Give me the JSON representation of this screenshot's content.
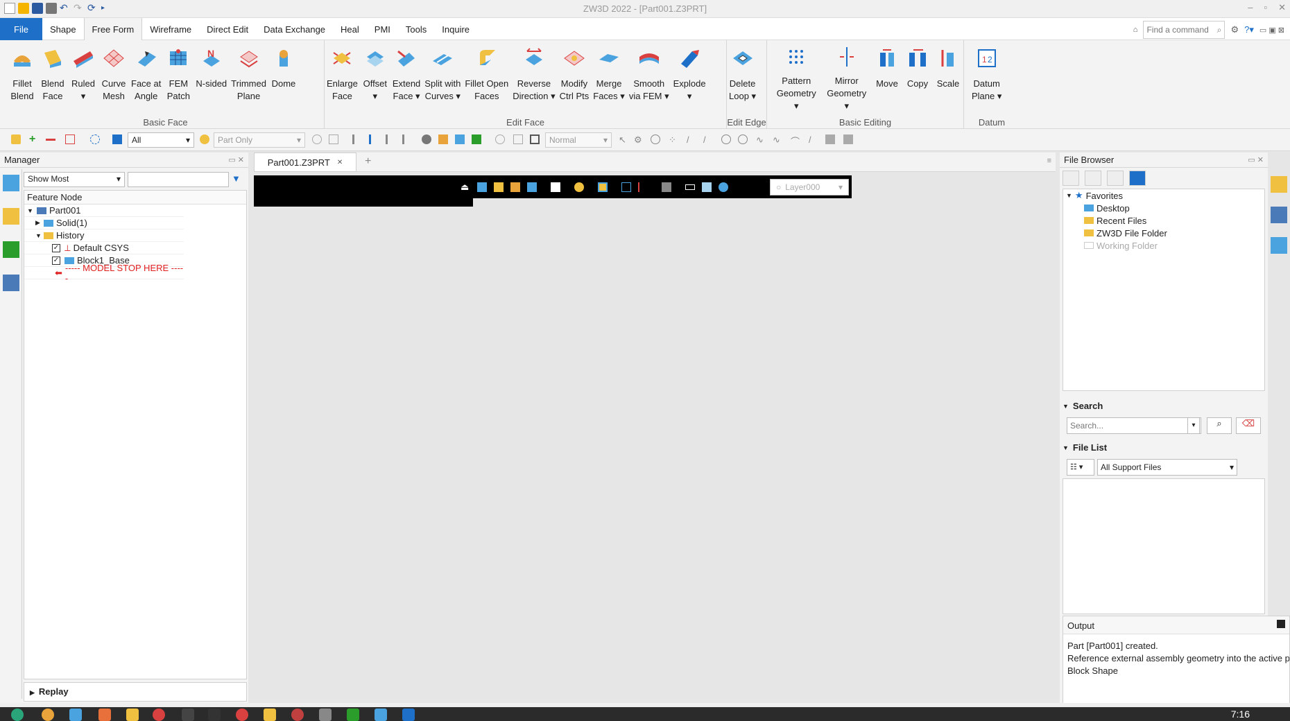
{
  "window": {
    "title": "ZW3D 2022 - [Part001.Z3PRT]"
  },
  "menu": {
    "tabs": [
      "File",
      "Shape",
      "Free Form",
      "Wireframe",
      "Direct Edit",
      "Data Exchange",
      "Heal",
      "PMI",
      "Tools",
      "Inquire"
    ],
    "active": "Free Form",
    "find_placeholder": "Find a command"
  },
  "ribbon": {
    "basic_face": {
      "name": "Basic Face",
      "buttons": [
        "Fillet\nBlend",
        "Blend\nFace",
        "Ruled\n▾",
        "Curve\nMesh",
        "Face at\nAngle",
        "FEM\nPatch",
        "N-sided",
        "Trimmed\nPlane",
        "Dome"
      ]
    },
    "edit_face": {
      "name": "Edit Face",
      "buttons": [
        "Enlarge\nFace",
        "Offset\n▾",
        "Extend\nFace ▾",
        "Split with\nCurves ▾",
        "Fillet Open\nFaces",
        "Reverse\nDirection ▾",
        "Modify\nCtrl Pts",
        "Merge\nFaces ▾",
        "Smooth\nvia FEM ▾",
        "Explode\n▾"
      ]
    },
    "edit_edge": {
      "name": "Edit Edge",
      "buttons": [
        "Delete\nLoop ▾"
      ]
    },
    "basic_editing": {
      "name": "Basic Editing",
      "buttons": [
        "Pattern\nGeometry ▾",
        "Mirror\nGeometry ▾",
        "Move",
        "Copy",
        "Scale"
      ]
    },
    "datum": {
      "name": "Datum",
      "buttons": [
        "Datum\nPlane ▾"
      ]
    }
  },
  "toolbar2": {
    "filter": "All",
    "part_filter": "Part Only",
    "render_mode": "Normal"
  },
  "manager": {
    "title": "Manager",
    "show_most": "Show Most",
    "tree_header": "Feature Node",
    "nodes": [
      "Part001",
      "Solid(1)",
      "History",
      "Default CSYS",
      "Block1_Base",
      "----- MODEL STOP HERE -----"
    ],
    "replay": "Replay"
  },
  "viewport": {
    "doc_tab": "Part001.Z3PRT",
    "doc_tab_close": "✕",
    "add_tab": "+",
    "layer": "Layer000"
  },
  "file_browser": {
    "title": "File Browser",
    "tree": [
      "Favorites",
      "Desktop",
      "Recent Files",
      "ZW3D File Folder",
      "Working Folder"
    ],
    "search_title": "Search",
    "search_placeholder": "Search...",
    "file_list_title": "File List",
    "file_filter": "All Support Files"
  },
  "output": {
    "title": "Output",
    "lines": [
      "Part [Part001] created.",
      "Reference external assembly geometry into the active par",
      "Block Shape"
    ]
  },
  "taskbar": {
    "time": "7:16"
  },
  "colors": {
    "accent": "#1e6fc8",
    "stop_marker": "#e02020"
  }
}
